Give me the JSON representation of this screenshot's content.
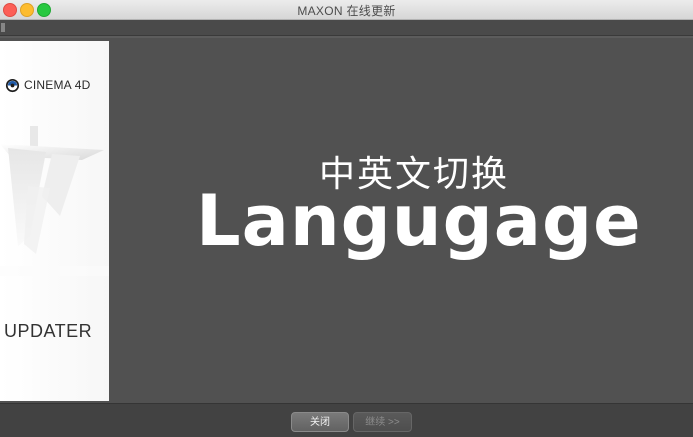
{
  "window": {
    "title": "MAXON 在线更新"
  },
  "sidebar": {
    "brand": "CINEMA 4D",
    "product": "UPDATER"
  },
  "main": {
    "headline_cn": "中英文切换",
    "headline_en": "Langugage"
  },
  "footer": {
    "close_label": "关闭",
    "next_label": "继续 >>"
  },
  "colors": {
    "background": "#515151",
    "headline": "#ffffff",
    "traffic_close": "#fc5f57",
    "traffic_min": "#fdbc2e",
    "traffic_max": "#28c840"
  }
}
